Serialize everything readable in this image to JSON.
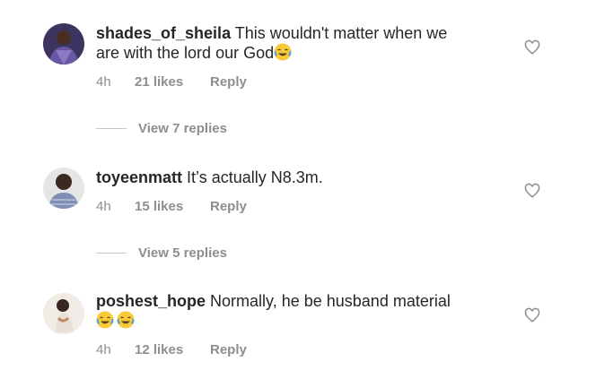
{
  "comments": [
    {
      "username": "shades_of_sheila",
      "text_line1": "This wouldn't matter when we",
      "text_line2": "are with the lord our God",
      "emoji": "tears-of-joy",
      "time": "4h",
      "likes": "21 likes",
      "reply": "Reply",
      "avatar_colors": {
        "bg": "#4b3b6e",
        "skin": "#5a3a2c"
      }
    },
    {
      "username": "toyeenmatt",
      "text_line1": "It’s actually N8.3m.",
      "time": "4h",
      "likes": "15 likes",
      "reply": "Reply",
      "avatar_colors": {
        "bg": "#e7e7e7",
        "skin": "#3b2a22",
        "shirt": "#7f8fb3"
      }
    },
    {
      "username": "poshest_hope",
      "text_line1": "Normally, he be husband material",
      "emoji_count": 2,
      "time": "4h",
      "likes": "12 likes",
      "reply": "Reply",
      "avatar_colors": {
        "bg": "#f1ece6",
        "skin": "#c08a68"
      }
    }
  ],
  "view_replies": [
    {
      "label": "View 7 replies"
    },
    {
      "label": "View 5 replies"
    }
  ],
  "colors": {
    "text": "#262626",
    "secondary": "#8e8e8e",
    "divider": "#c7c7c7",
    "heart_stroke": "#8e8e8e",
    "emoji_face": "#f9c938"
  },
  "icons": {
    "like": "heart-outline-icon",
    "emoji": "face-with-tears-of-joy-icon"
  }
}
